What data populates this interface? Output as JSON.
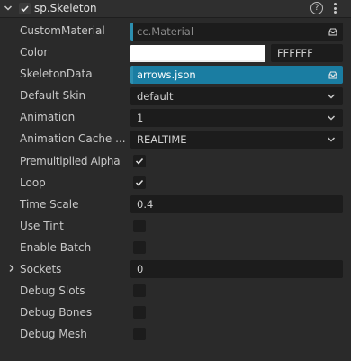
{
  "header": {
    "title": "sp.Skeleton",
    "help_glyph": "?"
  },
  "properties": {
    "custom_material": {
      "label": "CustomMaterial",
      "placeholder": "cc.Material"
    },
    "color": {
      "label": "Color",
      "hex": "FFFFFF",
      "value_color": "#ffffff"
    },
    "skeleton_data": {
      "label": "SkeletonData",
      "value": "arrows.json"
    },
    "default_skin": {
      "label": "Default Skin",
      "value": "default"
    },
    "animation": {
      "label": "Animation",
      "value": "1"
    },
    "animation_cache": {
      "label": "Animation Cache ...",
      "value": "REALTIME"
    },
    "premultiplied_alpha": {
      "label": "Premultiplied Alpha",
      "checked": true
    },
    "loop": {
      "label": "Loop",
      "checked": true
    },
    "time_scale": {
      "label": "Time Scale",
      "value": "0.4"
    },
    "use_tint": {
      "label": "Use Tint",
      "checked": false
    },
    "enable_batch": {
      "label": "Enable Batch",
      "checked": false
    },
    "sockets": {
      "label": "Sockets",
      "value": "0"
    },
    "debug_slots": {
      "label": "Debug Slots",
      "checked": false
    },
    "debug_bones": {
      "label": "Debug Bones",
      "checked": false
    },
    "debug_mesh": {
      "label": "Debug Mesh",
      "checked": false
    }
  },
  "colors": {
    "asset_accent": "#2d8fb0",
    "asset_filled": "#1a7da2",
    "panel_bg": "#2a2a2a",
    "field_bg": "#1c1c1c"
  }
}
